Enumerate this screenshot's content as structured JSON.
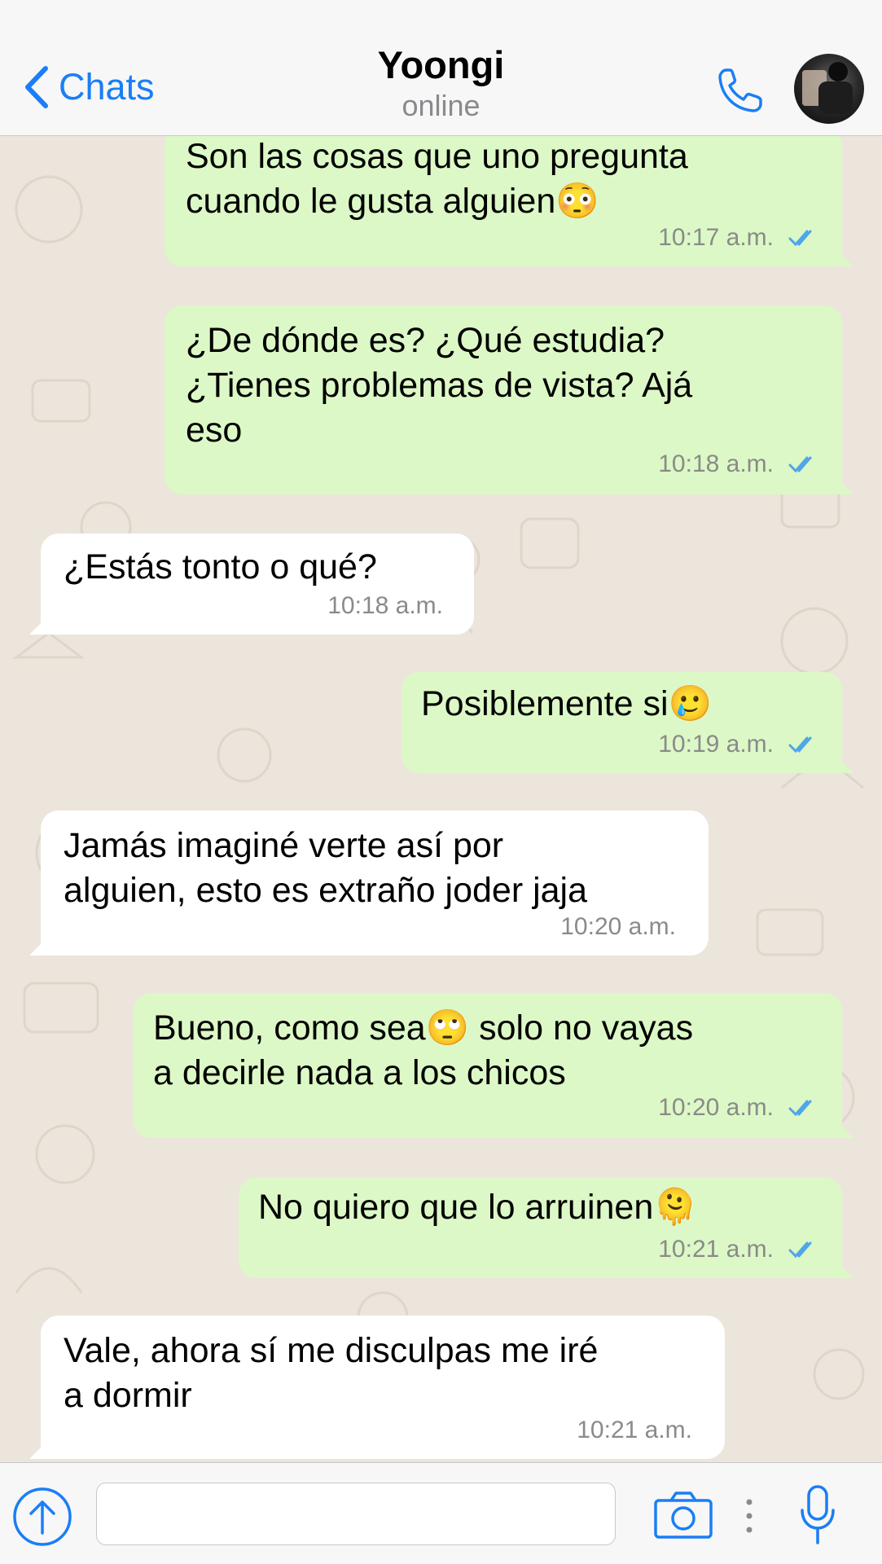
{
  "header": {
    "back_label": "Chats",
    "contact_name": "Yoongi",
    "contact_status": "online"
  },
  "messages": [
    {
      "direction": "out",
      "text": "Son las cosas que uno pregunta\ncuando le gusta alguien😳",
      "time": "10:17 a.m.",
      "read": true
    },
    {
      "direction": "out",
      "text": "¿De dónde es? ¿Qué estudia?\n¿Tienes problemas de vista? Ajá\neso",
      "time": "10:18 a.m.",
      "read": true
    },
    {
      "direction": "in",
      "text": "¿Estás tonto o qué?",
      "time": "10:18 a.m."
    },
    {
      "direction": "out",
      "text": "Posiblemente si🥲",
      "time": "10:19 a.m.",
      "read": true
    },
    {
      "direction": "in",
      "text": "Jamás imaginé verte así por\nalguien, esto es extraño joder jaja",
      "time": "10:20 a.m."
    },
    {
      "direction": "out",
      "text": "Bueno, como sea🙄 solo no vayas\na decirle nada a los chicos",
      "time": "10:20 a.m.",
      "read": true
    },
    {
      "direction": "out",
      "text": "No quiero que lo arruinen🫠",
      "time": "10:21 a.m.",
      "read": true
    },
    {
      "direction": "in",
      "text": "Vale, ahora sí me disculpas me iré\na dormir",
      "time": "10:21 a.m."
    }
  ],
  "input": {
    "placeholder": "",
    "value": ""
  },
  "icons": {
    "back": "chevron-left-icon",
    "call": "phone-icon",
    "attach": "arrow-up-circle-icon",
    "camera": "camera-icon",
    "more": "vertical-dots-icon",
    "mic": "microphone-icon"
  },
  "colors": {
    "accent": "#1a7ef6",
    "outgoing_bubble": "#dcf8c6",
    "incoming_bubble": "#ffffff",
    "chat_background": "#ece5dc",
    "read_ticks": "#4fa6e8"
  }
}
